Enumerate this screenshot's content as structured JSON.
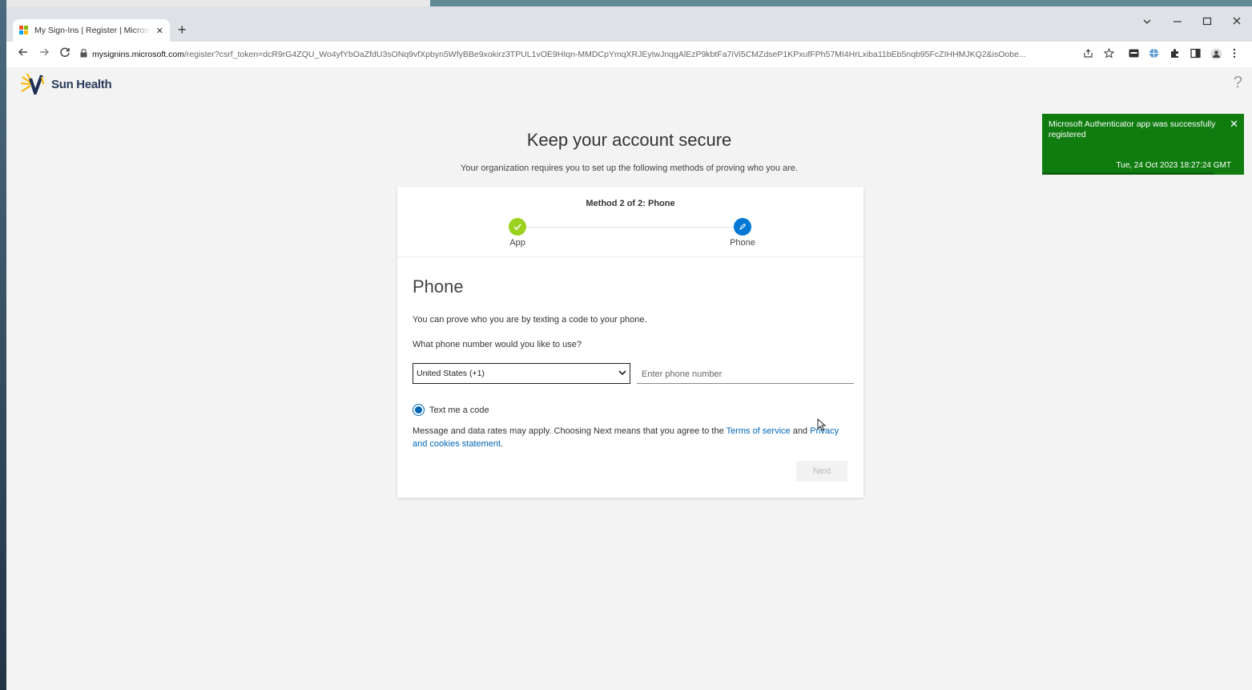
{
  "browser": {
    "tab_title": "My Sign-Ins | Register | Microsoft",
    "tab_close": "✕",
    "new_tab": "+",
    "url_domain": "mysignins.microsoft.com",
    "url_path": "/register?csrf_token=dcR9rG4ZQU_Wo4yfYbOaZfdU3sONq9vfXpbyn5WfyBBe9xokirz3TPUL1vOE9HIqn-MMDCpYmqXRJEytwJnqgAlEzP9kbtFa7iVi5CMZdseP1KPxufFPh57MI4HrLxiba11bEb5nqb95FcZIHHMJKQ2&isOobe..."
  },
  "header": {
    "logo_text": "Sun Health",
    "help": "?"
  },
  "main": {
    "title": "Keep your account secure",
    "subtitle": "Your organization requires you to set up the following methods of proving who you are."
  },
  "wizard": {
    "method_text": "Method 2 of 2: Phone",
    "steps": [
      {
        "label": "App",
        "state": "complete"
      },
      {
        "label": "Phone",
        "state": "current"
      }
    ],
    "colors": {
      "complete": "#9bd11f",
      "current": "#0078d4"
    }
  },
  "phone": {
    "title": "Phone",
    "intro": "You can prove who you are by texting a code to your phone.",
    "question": "What phone number would you like to use?",
    "country_value": "United States (+1)",
    "phone_placeholder": "Enter phone number",
    "option_label": "Text me a code",
    "disclaimer_prefix": "Message and data rates may apply. Choosing Next means that you agree to the ",
    "terms_link": "Terms of service",
    "and_text": " and ",
    "privacy_link": "Privacy and cookies statement",
    "period": ".",
    "next_label": "Next"
  },
  "toast": {
    "message": "Microsoft Authenticator app was successfully registered",
    "timestamp": "Tue, 24 Oct 2023 18:27:24 GMT",
    "close": "✕",
    "color": "#107c10"
  }
}
